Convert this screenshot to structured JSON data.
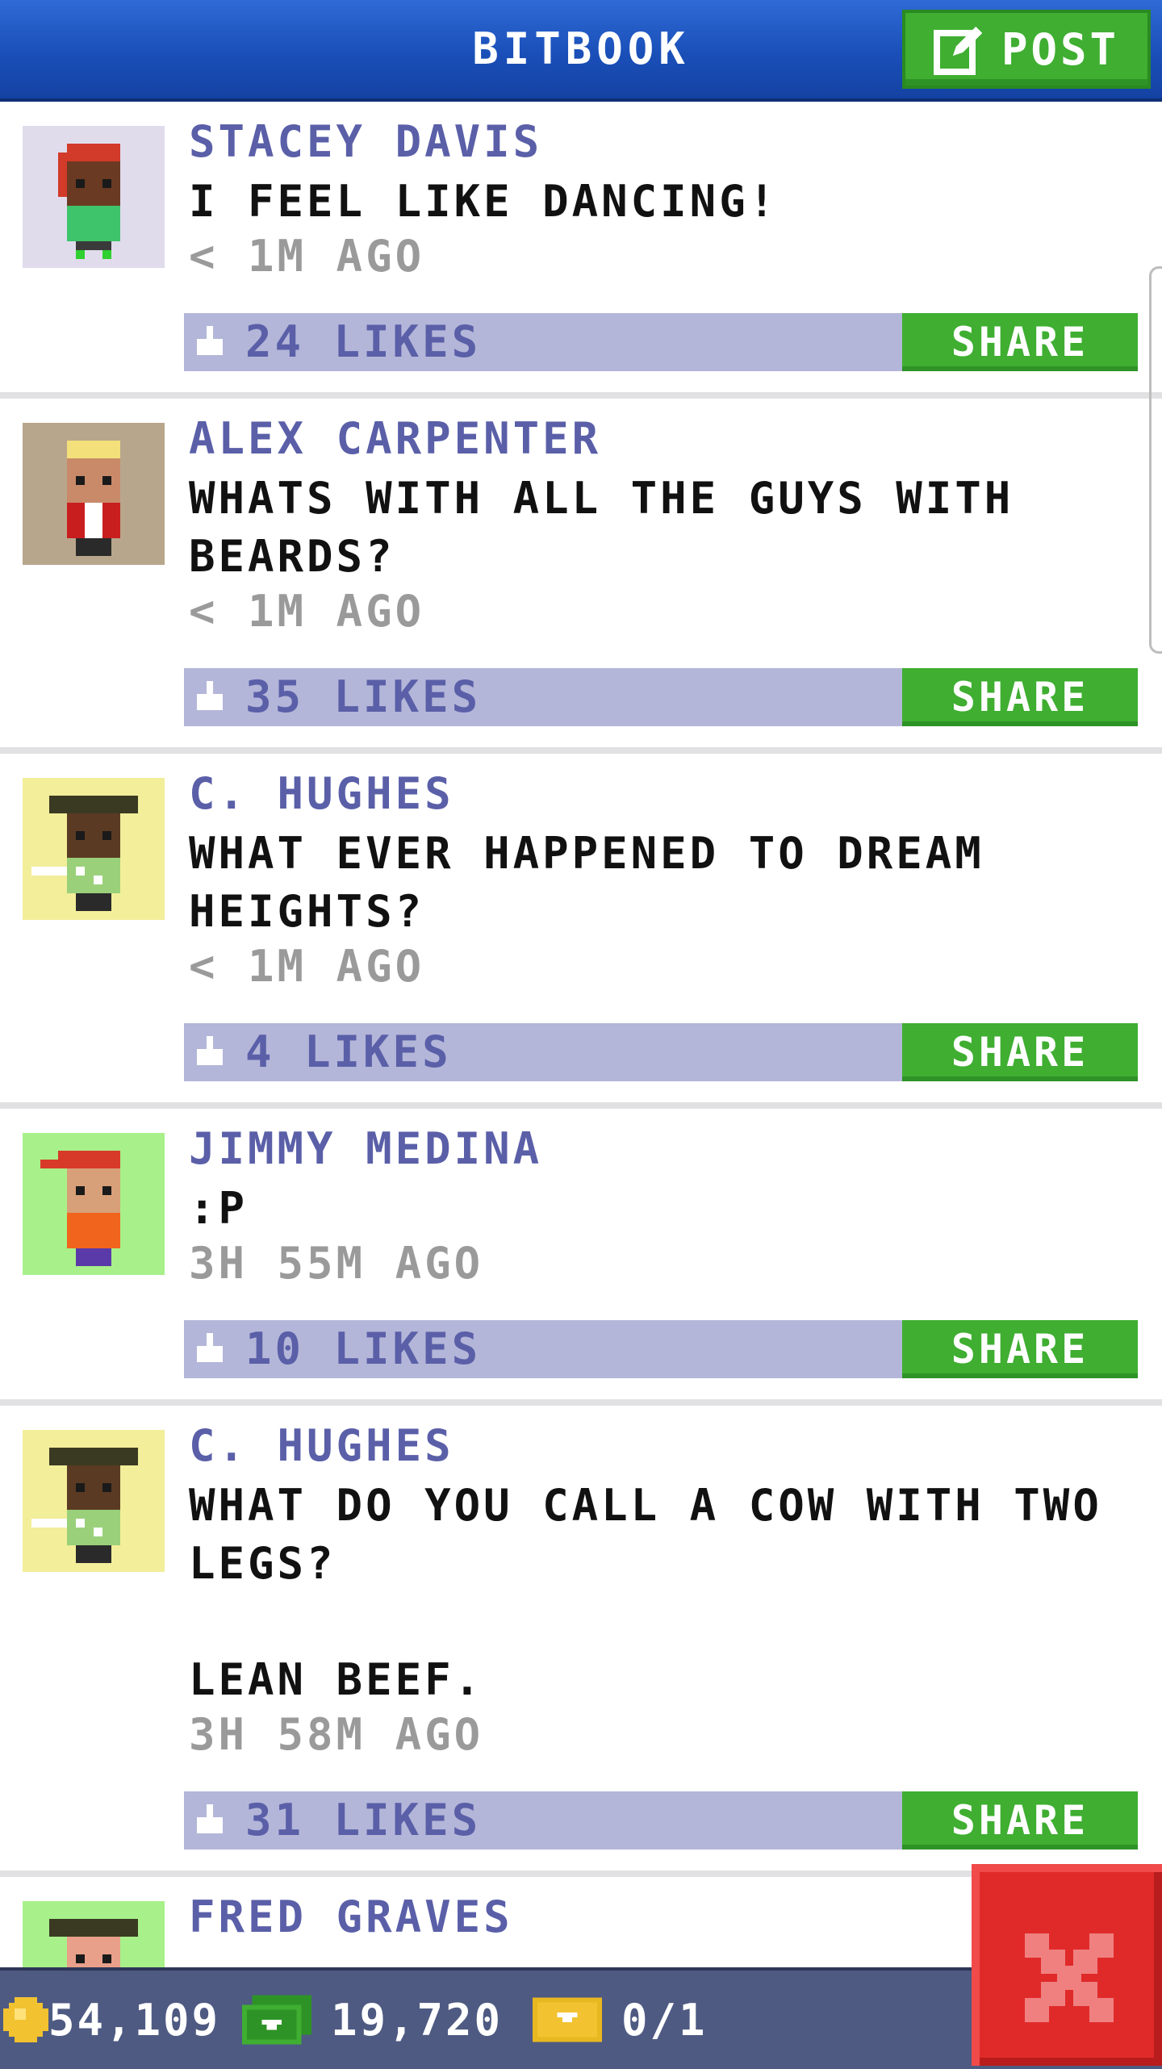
{
  "header": {
    "title": "BITBOOK",
    "post_label": "POST"
  },
  "posts": [
    {
      "name": "STACEY DAVIS",
      "message": "I FEEL LIKE DANCING!",
      "time": "< 1M AGO",
      "likes": "24 LIKES",
      "share": "SHARE",
      "avatar_bg": "#e0dcec"
    },
    {
      "name": "ALEX CARPENTER",
      "message": "WHATS WITH ALL THE GUYS WITH\nBEARDS?",
      "time": "< 1M AGO",
      "likes": "35 LIKES",
      "share": "SHARE",
      "avatar_bg": "#b8a68c"
    },
    {
      "name": "C. HUGHES",
      "message": "WHAT EVER HAPPENED TO DREAM\nHEIGHTS?",
      "time": "< 1M AGO",
      "likes": "4 LIKES",
      "share": "SHARE",
      "avatar_bg": "#f2ee9a"
    },
    {
      "name": "JIMMY MEDINA",
      "message": ":P",
      "time": "3H 55M AGO",
      "likes": "10 LIKES",
      "share": "SHARE",
      "avatar_bg": "#a8f08a"
    },
    {
      "name": "C. HUGHES",
      "message": "WHAT DO YOU CALL A COW WITH TWO\nLEGS?\n\nLEAN BEEF.",
      "time": "3H 58M AGO",
      "likes": "31 LIKES",
      "share": "SHARE",
      "avatar_bg": "#f2ee9a"
    },
    {
      "name": "FRED GRAVES",
      "message": "",
      "time": "",
      "likes": "",
      "share": "",
      "avatar_bg": "#a8f08a"
    }
  ],
  "bottom_bar": {
    "coins": "54,109",
    "bux": "19,720",
    "tickets": "0/1"
  },
  "colors": {
    "header_blue": "#1a4fb8",
    "button_green": "#3fae31",
    "name_purple": "#5a5fa8",
    "likes_bar": "#b3b6d8",
    "close_red": "#e02a2a"
  }
}
